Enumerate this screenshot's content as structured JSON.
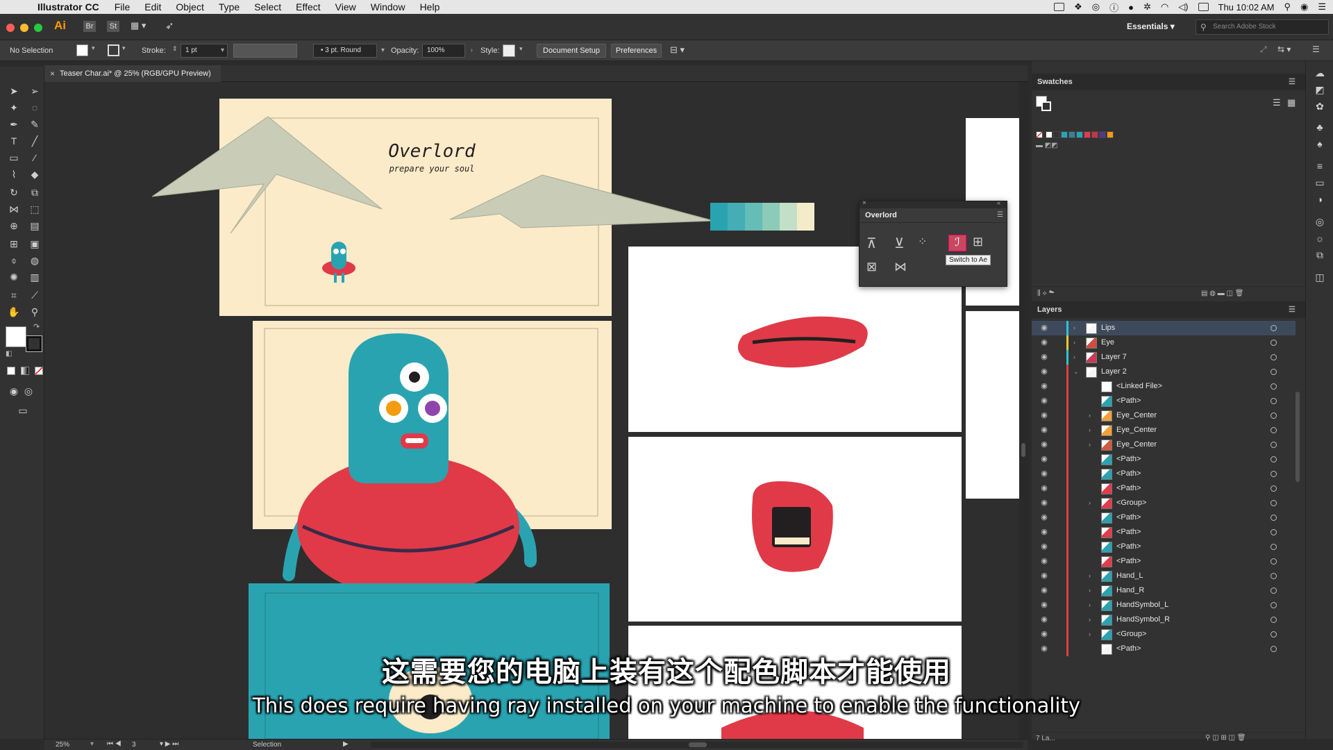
{
  "menubar": {
    "app_name": "Illustrator CC",
    "items": [
      "File",
      "Edit",
      "Object",
      "Type",
      "Select",
      "Effect",
      "View",
      "Window",
      "Help"
    ],
    "clock": "Thu 10:02 AM"
  },
  "appbar": {
    "logo": "Ai",
    "bridge": "Br",
    "stock": "St",
    "workspace": "Essentials",
    "search_placeholder": "Search Adobe Stock"
  },
  "control": {
    "selection": "No Selection",
    "stroke_label": "Stroke:",
    "stroke_value": "1 pt",
    "brush": "3 pt. Round",
    "opacity_label": "Opacity:",
    "opacity_value": "100%",
    "style_label": "Style:",
    "doc_setup": "Document Setup",
    "preferences": "Preferences"
  },
  "document": {
    "tab": "Teaser Char.ai* @ 25% (RGB/GPU Preview)"
  },
  "artwork": {
    "title": "Overlord",
    "subtitle": "prepare your soul",
    "palette": [
      "#2aa3b1",
      "#44adb6",
      "#66bcb6",
      "#8ccbb7",
      "#c3e0c6",
      "#f4ecc9"
    ]
  },
  "float_panel": {
    "title": "Overlord",
    "tooltip": "Switch to Ae"
  },
  "swatches": {
    "title": "Swatches",
    "colors": [
      "#ffffff",
      "#333333",
      "#2aa3b1",
      "#3a7f98",
      "#2aa3b1",
      "#e23b4a",
      "#c8324a",
      "#4d3a8c",
      "#f39c12"
    ]
  },
  "layers": {
    "title": "Layers",
    "count": "7 La...",
    "rows": [
      {
        "name": "Lips",
        "indent": 0,
        "expand": "›",
        "bar": "#2ec4d6",
        "thumb": "#f5f5f5",
        "selected": true
      },
      {
        "name": "Eye",
        "indent": 0,
        "expand": "›",
        "bar": "#e8c93a",
        "thumb": "#d24b3f",
        "selected": false
      },
      {
        "name": "Layer 7",
        "indent": 0,
        "expand": "›",
        "bar": "#2ec4d6",
        "thumb": "#c83a55",
        "selected": false
      },
      {
        "name": "Layer 2",
        "indent": 0,
        "expand": "⌄",
        "bar": "#e03f3f",
        "thumb": "#f5f5f5",
        "selected": false
      },
      {
        "name": "<Linked File>",
        "indent": 1,
        "expand": "",
        "bar": "#e03f3f",
        "thumb": "#ffffff",
        "selected": false
      },
      {
        "name": "<Path>",
        "indent": 1,
        "expand": "",
        "bar": "#e03f3f",
        "thumb": "#2aa3b1",
        "selected": false
      },
      {
        "name": "Eye_Center",
        "indent": 1,
        "expand": "›",
        "bar": "#e03f3f",
        "thumb": "#f0a23a",
        "selected": false
      },
      {
        "name": "Eye_Center",
        "indent": 1,
        "expand": "›",
        "bar": "#e03f3f",
        "thumb": "#f0a23a",
        "selected": false
      },
      {
        "name": "Eye_Center",
        "indent": 1,
        "expand": "›",
        "bar": "#e03f3f",
        "thumb": "#d2593f",
        "selected": false
      },
      {
        "name": "<Path>",
        "indent": 1,
        "expand": "",
        "bar": "#e03f3f",
        "thumb": "#2aa3b1",
        "selected": false
      },
      {
        "name": "<Path>",
        "indent": 1,
        "expand": "",
        "bar": "#e03f3f",
        "thumb": "#2aa3b1",
        "selected": false
      },
      {
        "name": "<Path>",
        "indent": 1,
        "expand": "",
        "bar": "#e03f3f",
        "thumb": "#e23b4a",
        "selected": false
      },
      {
        "name": "<Group>",
        "indent": 1,
        "expand": "›",
        "bar": "#e03f3f",
        "thumb": "#e23b4a",
        "selected": false
      },
      {
        "name": "<Path>",
        "indent": 1,
        "expand": "",
        "bar": "#e03f3f",
        "thumb": "#2aa3b1",
        "selected": false
      },
      {
        "name": "<Path>",
        "indent": 1,
        "expand": "",
        "bar": "#e03f3f",
        "thumb": "#e23b4a",
        "selected": false
      },
      {
        "name": "<Path>",
        "indent": 1,
        "expand": "",
        "bar": "#e03f3f",
        "thumb": "#2aa3b1",
        "selected": false
      },
      {
        "name": "<Path>",
        "indent": 1,
        "expand": "",
        "bar": "#e03f3f",
        "thumb": "#e23b4a",
        "selected": false
      },
      {
        "name": "Hand_L",
        "indent": 1,
        "expand": "›",
        "bar": "#e03f3f",
        "thumb": "#2aa3b1",
        "selected": false
      },
      {
        "name": "Hand_R",
        "indent": 1,
        "expand": "›",
        "bar": "#e03f3f",
        "thumb": "#2aa3b1",
        "selected": false
      },
      {
        "name": "HandSymbol_L",
        "indent": 1,
        "expand": "›",
        "bar": "#e03f3f",
        "thumb": "#2aa3b1",
        "selected": false
      },
      {
        "name": "HandSymbol_R",
        "indent": 1,
        "expand": "›",
        "bar": "#e03f3f",
        "thumb": "#2aa3b1",
        "selected": false
      },
      {
        "name": "<Group>",
        "indent": 1,
        "expand": "›",
        "bar": "#e03f3f",
        "thumb": "#2aa3b1",
        "selected": false
      },
      {
        "name": "<Path>",
        "indent": 1,
        "expand": "",
        "bar": "#e03f3f",
        "thumb": "#f5f5f5",
        "selected": false
      }
    ]
  },
  "status": {
    "zoom": "25%",
    "artboard": "3",
    "tool": "Selection"
  },
  "subtitles": {
    "zh": "这需要您的电脑上装有这个配色脚本才能使用",
    "en": "This does require having ray installed on your machine to enable the functionality"
  }
}
